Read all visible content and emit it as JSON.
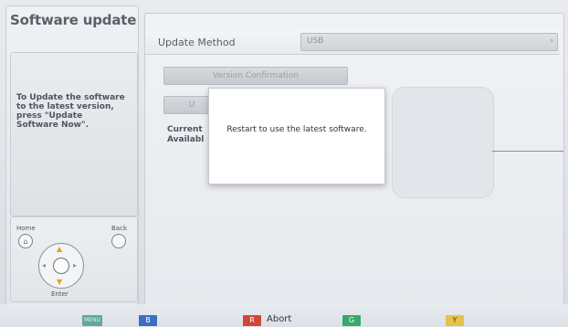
{
  "side": {
    "title": "Software update",
    "help_text": "To Update the software to the latest version, press \"Update Software Now\"."
  },
  "remote": {
    "home_label": "Home",
    "back_label": "Back",
    "enter_label": "Enter"
  },
  "main": {
    "method_label": "Update Method",
    "method_value": "USB",
    "version_button": "Version Confirmation",
    "update_button": "U",
    "current_label": "Current",
    "available_label": "Availabl"
  },
  "dialog": {
    "message": "Restart to use the latest software."
  },
  "footer": {
    "menu_key": "MENU",
    "blue_key": "B",
    "red_key": "R",
    "red_label": "Abort",
    "green_key": "G",
    "yellow_key": "Y"
  },
  "colors": {
    "blue": "#3a6fc4",
    "red": "#d0473a",
    "green": "#38a86b",
    "yellow": "#e7c24a"
  }
}
